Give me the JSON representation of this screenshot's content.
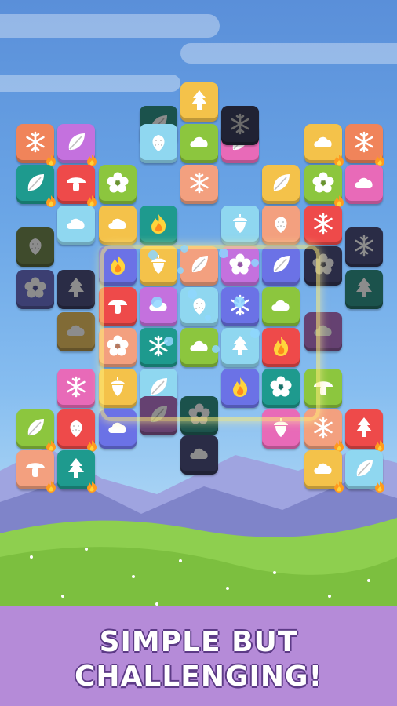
{
  "banner": {
    "line1": "SIMPLE BUT",
    "line2": "CHALLENGING!",
    "color": "#b58bd8"
  },
  "palette": {
    "orange": "#f0845a",
    "yellow": "#f4c24a",
    "green": "#8cc63e",
    "teal": "#1e9a8e",
    "lightblue": "#8fd7f0",
    "blue": "#6b72e6",
    "purple": "#c471de",
    "pink": "#e86ab8",
    "red": "#ee4a4a",
    "peach": "#f3a07f",
    "olive": "#6f8a45",
    "navy": "#4a4f8a"
  },
  "board": {
    "tiles": [
      {
        "color": "orange",
        "icon": "snowflake",
        "fire": true,
        "state": "free"
      },
      {
        "color": "purple",
        "icon": "leaf",
        "fire": true,
        "state": "free"
      },
      {
        "color": "teal",
        "icon": "leaf",
        "fire": true,
        "state": "free"
      },
      {
        "color": "red",
        "icon": "mushroom",
        "fire": true,
        "state": "free"
      },
      {
        "color": "yellow",
        "icon": "tree",
        "fire": false,
        "state": "free"
      },
      {
        "color": "teal",
        "icon": "leaf",
        "fire": false,
        "state": "dim"
      },
      {
        "color": "lightblue",
        "icon": "strawberry",
        "fire": false,
        "state": "free"
      },
      {
        "color": "green",
        "icon": "cloud",
        "fire": false,
        "state": "free"
      },
      {
        "color": "pink",
        "icon": "leaf",
        "fire": false,
        "state": "free"
      },
      {
        "color": "navy",
        "icon": "snowflake",
        "fire": false,
        "state": "far"
      },
      {
        "color": "green",
        "icon": "flower",
        "fire": false,
        "state": "free"
      },
      {
        "color": "peach",
        "icon": "snowflake",
        "fire": false,
        "state": "free"
      },
      {
        "color": "yellow",
        "icon": "leaf",
        "fire": false,
        "state": "free"
      },
      {
        "color": "yellow",
        "icon": "cloud",
        "fire": true,
        "state": "free"
      },
      {
        "color": "orange",
        "icon": "snowflake",
        "fire": true,
        "state": "free"
      },
      {
        "color": "green",
        "icon": "flower",
        "fire": true,
        "state": "free"
      },
      {
        "color": "pink",
        "icon": "cloud",
        "fire": false,
        "state": "free"
      },
      {
        "color": "lightblue",
        "icon": "cloud",
        "fire": false,
        "state": "free"
      },
      {
        "color": "yellow",
        "icon": "cloud",
        "fire": false,
        "state": "free"
      },
      {
        "color": "teal",
        "icon": "fire",
        "fire": false,
        "state": "free"
      },
      {
        "color": "lightblue",
        "icon": "acorn",
        "fire": false,
        "state": "free"
      },
      {
        "color": "peach",
        "icon": "strawberry",
        "fire": false,
        "state": "free"
      },
      {
        "color": "red",
        "icon": "snowflake",
        "fire": false,
        "state": "free"
      },
      {
        "color": "olive",
        "icon": "strawberry",
        "fire": false,
        "state": "dim"
      },
      {
        "color": "navy",
        "icon": "snowflake",
        "fire": false,
        "state": "dim"
      },
      {
        "color": "blue",
        "icon": "flower",
        "fire": false,
        "state": "dim"
      },
      {
        "color": "navy",
        "icon": "tree",
        "fire": false,
        "state": "dim"
      },
      {
        "color": "blue",
        "icon": "fire",
        "fire": false,
        "state": "free"
      },
      {
        "color": "yellow",
        "icon": "acorn",
        "fire": false,
        "state": "free"
      },
      {
        "color": "peach",
        "icon": "leaf",
        "fire": false,
        "state": "free"
      },
      {
        "color": "purple",
        "icon": "flower",
        "fire": false,
        "state": "free"
      },
      {
        "color": "blue",
        "icon": "leaf",
        "fire": false,
        "state": "free"
      },
      {
        "color": "navy",
        "icon": "flower",
        "fire": false,
        "state": "dim"
      },
      {
        "color": "teal",
        "icon": "tree",
        "fire": false,
        "state": "dim"
      },
      {
        "color": "yellow",
        "icon": "cloud",
        "fire": false,
        "state": "dim"
      },
      {
        "color": "red",
        "icon": "mushroom",
        "fire": false,
        "state": "free"
      },
      {
        "color": "purple",
        "icon": "cloud",
        "fire": false,
        "state": "free"
      },
      {
        "color": "lightblue",
        "icon": "strawberry",
        "fire": false,
        "state": "free"
      },
      {
        "color": "blue",
        "icon": "snowflake",
        "fire": false,
        "state": "free"
      },
      {
        "color": "green",
        "icon": "cloud",
        "fire": false,
        "state": "free"
      },
      {
        "color": "purple",
        "icon": "cloud",
        "fire": false,
        "state": "dim"
      },
      {
        "color": "peach",
        "icon": "flower",
        "fire": false,
        "state": "free"
      },
      {
        "color": "teal",
        "icon": "snowflake",
        "fire": false,
        "state": "free"
      },
      {
        "color": "green",
        "icon": "cloud",
        "fire": false,
        "state": "free"
      },
      {
        "color": "lightblue",
        "icon": "tree",
        "fire": false,
        "state": "free"
      },
      {
        "color": "red",
        "icon": "fire",
        "fire": false,
        "state": "free"
      },
      {
        "color": "pink",
        "icon": "snowflake",
        "fire": false,
        "state": "free"
      },
      {
        "color": "yellow",
        "icon": "acorn",
        "fire": false,
        "state": "free"
      },
      {
        "color": "lightblue",
        "icon": "leaf",
        "fire": false,
        "state": "free"
      },
      {
        "color": "blue",
        "icon": "fire",
        "fire": false,
        "state": "free"
      },
      {
        "color": "teal",
        "icon": "flower",
        "fire": false,
        "state": "free"
      },
      {
        "color": "green",
        "icon": "mushroom",
        "fire": false,
        "state": "free"
      },
      {
        "color": "blue",
        "icon": "cloud",
        "fire": false,
        "state": "free"
      },
      {
        "color": "purple",
        "icon": "leaf",
        "fire": false,
        "state": "dim"
      },
      {
        "color": "teal",
        "icon": "flower",
        "fire": false,
        "state": "dim"
      },
      {
        "color": "pink",
        "icon": "acorn",
        "fire": false,
        "state": "free"
      },
      {
        "color": "green",
        "icon": "leaf",
        "fire": true,
        "state": "free"
      },
      {
        "color": "red",
        "icon": "strawberry",
        "fire": true,
        "state": "free"
      },
      {
        "color": "peach",
        "icon": "snowflake",
        "fire": true,
        "state": "free"
      },
      {
        "color": "red",
        "icon": "tree",
        "fire": true,
        "state": "free"
      },
      {
        "color": "navy",
        "icon": "cloud",
        "fire": false,
        "state": "dim"
      },
      {
        "color": "peach",
        "icon": "mushroom",
        "fire": true,
        "state": "free"
      },
      {
        "color": "teal",
        "icon": "tree",
        "fire": true,
        "state": "free"
      },
      {
        "color": "yellow",
        "icon": "cloud",
        "fire": true,
        "state": "free"
      },
      {
        "color": "lightblue",
        "icon": "leaf",
        "fire": true,
        "state": "free"
      }
    ]
  }
}
